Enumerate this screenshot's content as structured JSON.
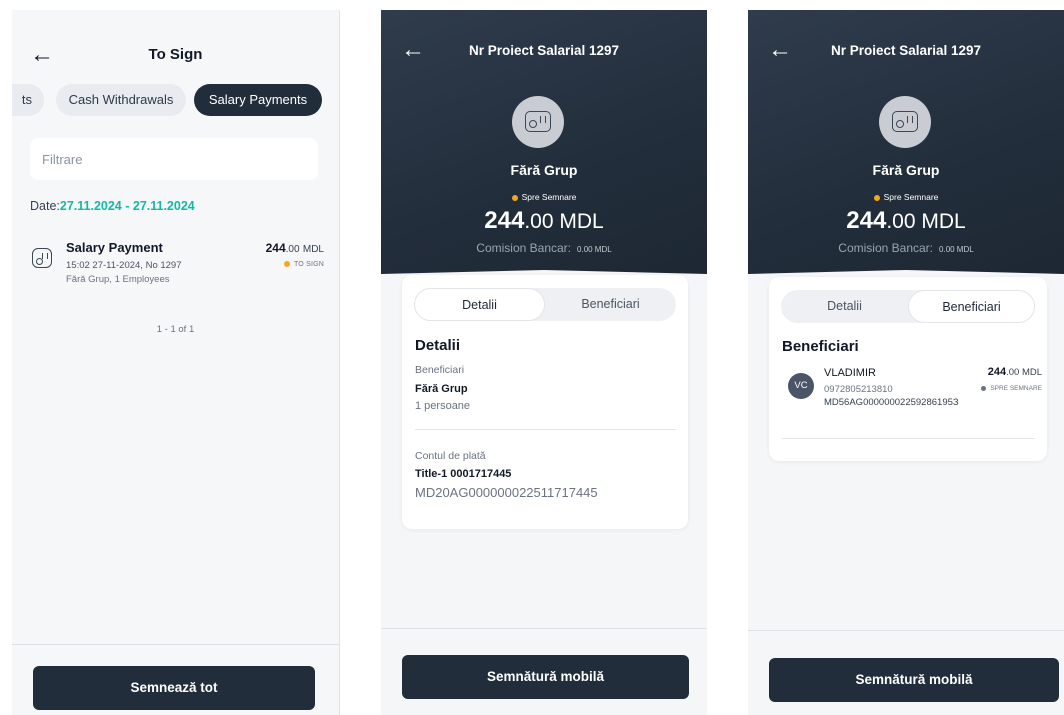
{
  "screen1": {
    "title": "To Sign",
    "tabs": [
      "ts",
      "Cash Withdrawals",
      "Salary Payments"
    ],
    "filter_placeholder": "Filtrare",
    "date_label": "Date:",
    "date_value": "27.11.2024 - 27.11.2024",
    "payment": {
      "title": "Salary Payment",
      "subtitle": "15:02 27-11-2024, No 1297",
      "details": "Fără Grup, 1 Employees",
      "amount_int": "244",
      "amount_dec": ".00",
      "currency": "MDL",
      "status": "TO SIGN"
    },
    "pager": "1 - 1 of 1",
    "sign_all_button": "Semnează tot"
  },
  "screen2": {
    "title": "Nr Proiect Salarial 1297",
    "group": "Fără Grup",
    "status": "Spre Semnare",
    "amount_int": "244",
    "amount_dec": ".00 MDL",
    "commission_label": "Comision Bancar:",
    "commission_value": "0.00 MDL",
    "tab_details": "Detalii",
    "tab_beneficiaries": "Beneficiari",
    "section_title": "Detalii",
    "beneficiari_label": "Beneficiari",
    "beneficiari_group": "Fără Grup",
    "beneficiari_count": "1 persoane",
    "account_label": "Contul de plată",
    "account_title": "Title-1 0001717445",
    "account_iban": "MD20AG000000022511717445",
    "sign_button": "Semnătură mobilă"
  },
  "screen3": {
    "title": "Nr Proiect Salarial 1297",
    "group": "Fără Grup",
    "status": "Spre Semnare",
    "amount_int": "244",
    "amount_dec": ".00 MDL",
    "commission_label": "Comision Bancar:",
    "commission_value": "0.00 MDL",
    "tab_details": "Detalii",
    "tab_beneficiaries": "Beneficiari",
    "section_title": "Beneficiari",
    "beneficiary": {
      "initials": "VC",
      "name": "VLADIMIR",
      "phone": "0972805213810",
      "iban": "MD56AG00000002259286195З",
      "amount_int": "244",
      "amount_dec": ".00 MDL",
      "status": "SPRE SEMNARE"
    },
    "sign_button": "Semnătură mobilă"
  },
  "colors": {
    "dark": "#222d3b",
    "accent_teal": "#15b8a6",
    "status_orange": "#f5a623"
  }
}
